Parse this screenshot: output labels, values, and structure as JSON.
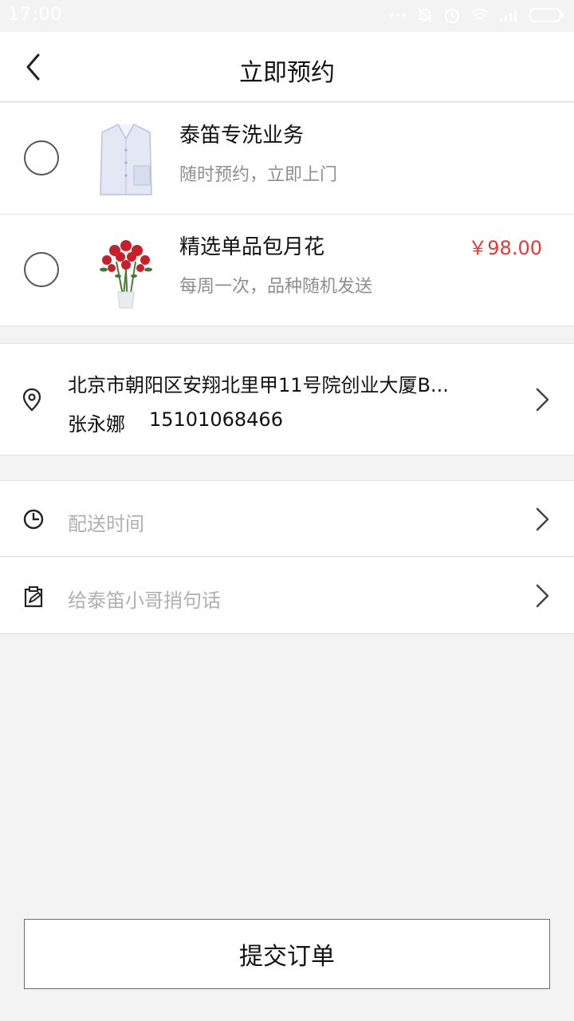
{
  "status_bar": {
    "time": "17:00",
    "icons": [
      "signal-dots-icon",
      "mute-bell-icon",
      "alarm-icon",
      "wifi-icon",
      "cell-signal-icon",
      "battery-icon"
    ]
  },
  "header": {
    "title": "立即预约",
    "back_icon": "chevron-left-icon"
  },
  "products": [
    {
      "name": "泰笛专洗业务",
      "desc": "随时预约，立即上门",
      "price": "",
      "image": "shirt",
      "selected": false
    },
    {
      "name": "精选单品包月花",
      "desc": "每周一次，品种随机发送",
      "price": "￥98.00",
      "image": "roses",
      "selected": false
    }
  ],
  "address": {
    "text": "北京市朝阳区安翔北里甲11号院创业大厦B...",
    "name": "张永娜",
    "phone": "15101068466",
    "icon": "location-pin-icon"
  },
  "options": {
    "delivery_time": {
      "label": "配送时间",
      "icon": "clock-icon"
    },
    "message": {
      "label": "给泰笛小哥捎句话",
      "icon": "edit-note-icon"
    }
  },
  "submit": {
    "label": "提交订单"
  },
  "colors": {
    "price": "#e23b3b",
    "background": "#f3f3f3",
    "placeholder": "#b0b0b0"
  }
}
